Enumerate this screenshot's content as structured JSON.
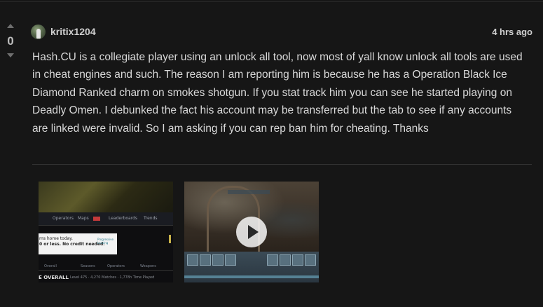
{
  "post": {
    "vote_count": "0",
    "author": "kritix1204",
    "timestamp": "4 hrs ago",
    "body": "Hash.CU is a collegiate player using an unlock all tool, now most of yall know unlock all tools are used in cheat engines and such. The reason I am reporting him is because he has a Operation Black Ice Diamond Ranked charm on smokes shotgun. If you stat track him you can see he started playing on Deadly Omen. I debunked the fact his account may be transferred but the tab to see if any accounts are linked were invalid. So I am asking if you can rep ban him for cheating. Thanks"
  },
  "attachments": {
    "image_thumb": {
      "nav": [
        "Operators",
        "Maps",
        "Leaderboards",
        "Trends"
      ],
      "ad_line1": "ms home today.",
      "ad_line2": "0 or less. No credit needed.",
      "ad_brand": "Progressive Leasing",
      "tabs": [
        "Overall",
        "Seasons",
        "Operators",
        "Weapons"
      ],
      "overall_label": "E OVERALL",
      "stats_line": "Level 475 · 4,270 Matches · 1,778h Time Played"
    },
    "video_thumb": {
      "play_icon": "play-icon"
    }
  },
  "colors": {
    "background": "#161616",
    "text": "#d9d9d9",
    "muted": "#6f6f6f"
  }
}
